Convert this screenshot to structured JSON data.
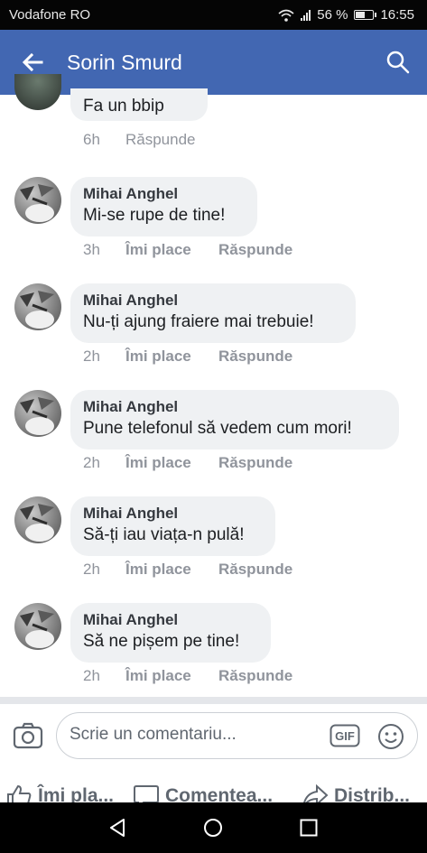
{
  "status_bar": {
    "carrier": "Vodafone RO",
    "battery": "56 %",
    "battery_level": 0.56,
    "time": "16:55"
  },
  "header": {
    "title": "Sorin Smurd",
    "back_icon": "arrow-left-icon",
    "search_icon": "search-icon",
    "color": "#4267b2"
  },
  "partial_comment": {
    "text": "Fa un bbip",
    "time": "6h",
    "reply": "Răspunde"
  },
  "comments": [
    {
      "author": "Mihai Anghel",
      "text": "Mi-se rupe de tine!",
      "time": "3h",
      "like": "Îmi place",
      "reply": "Răspunde"
    },
    {
      "author": "Mihai Anghel",
      "text": "Nu-ți ajung fraiere mai trebuie!",
      "time": "2h",
      "like": "Îmi place",
      "reply": "Răspunde"
    },
    {
      "author": "Mihai Anghel",
      "text": "Pune telefonul să vedem cum mori!",
      "time": "2h",
      "like": "Îmi place",
      "reply": "Răspunde"
    },
    {
      "author": "Mihai Anghel",
      "text": "Să-ți iau viața-n pulă!",
      "time": "2h",
      "like": "Îmi place",
      "reply": "Răspunde"
    },
    {
      "author": "Mihai Anghel",
      "text": "Să ne pișem pe tine!",
      "time": "2h",
      "like": "Îmi place",
      "reply": "Răspunde"
    }
  ],
  "composer": {
    "placeholder": "Scrie un comentariu...",
    "camera_icon": "camera-icon",
    "gif_label": "GIF",
    "emoji_icon": "smiley-icon"
  },
  "actions": {
    "like": "Îmi pla...",
    "comment": "Comentea...",
    "share": "Distrib..."
  },
  "nav_bar": {
    "back_icon": "triangle-back-icon",
    "home_icon": "circle-home-icon",
    "recents_icon": "square-recents-icon"
  }
}
